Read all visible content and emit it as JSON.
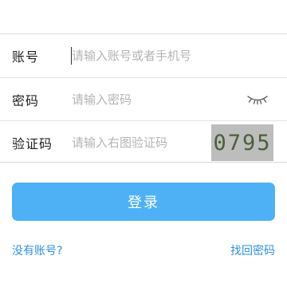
{
  "form": {
    "account": {
      "label": "账号",
      "placeholder": "请输入账号或者手机号",
      "value": ""
    },
    "password": {
      "label": "密码",
      "placeholder": "请输入密码",
      "value": "",
      "toggle_icon": "eye-closed-icon"
    },
    "captcha": {
      "label": "验证码",
      "placeholder": "请输入右图验证码",
      "value": "",
      "image_code": "0795"
    }
  },
  "actions": {
    "login_label": "登录"
  },
  "links": {
    "no_account": "没有账号?",
    "forgot_password": "找回密码"
  },
  "colors": {
    "primary": "#4eb1f5",
    "link": "#2e8fe0",
    "placeholder": "#b3b3b3",
    "divider": "#e2e2e2",
    "captcha_bg": "#bdbdbd"
  }
}
